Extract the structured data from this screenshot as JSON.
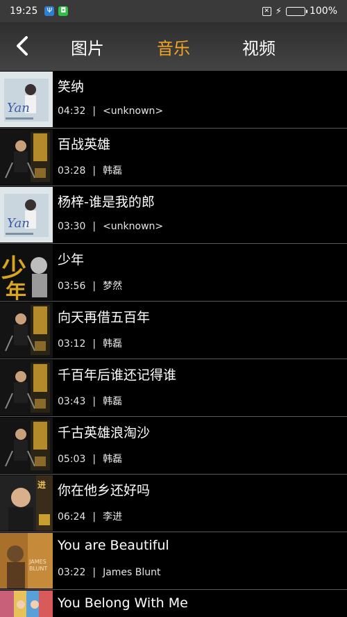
{
  "status": {
    "time": "19:25",
    "battery_percent": "100%",
    "battery_level": 1.0
  },
  "header": {
    "tabs": [
      {
        "label": "图片",
        "active": false
      },
      {
        "label": "音乐",
        "active": true
      },
      {
        "label": "视频",
        "active": false
      }
    ],
    "active_color": "#f5a623"
  },
  "songs": [
    {
      "title": "笑纳",
      "duration": "04:32",
      "sep": "|",
      "artist": "<unknown>",
      "art": "light"
    },
    {
      "title": "百战英雄",
      "duration": "03:28",
      "sep": "|",
      "artist": "韩磊",
      "art": "dark-gold"
    },
    {
      "title": "杨梓-谁是我的郎",
      "duration": "03:30",
      "sep": "|",
      "artist": "<unknown>",
      "art": "light"
    },
    {
      "title": "少年",
      "duration": "03:56",
      "sep": "|",
      "artist": "梦然",
      "art": "gold-text"
    },
    {
      "title": "向天再借五百年",
      "duration": "03:12",
      "sep": "|",
      "artist": "韩磊",
      "art": "dark-gold"
    },
    {
      "title": "千百年后谁还记得谁",
      "duration": "03:43",
      "sep": "|",
      "artist": "韩磊",
      "art": "dark-gold"
    },
    {
      "title": "千古英雄浪淘沙",
      "duration": "05:03",
      "sep": "|",
      "artist": "韩磊",
      "art": "dark-gold"
    },
    {
      "title": "你在他乡还好吗",
      "duration": "06:24",
      "sep": "|",
      "artist": "李进",
      "art": "portrait"
    },
    {
      "title": "You are Beautiful",
      "duration": "03:22",
      "sep": "|",
      "artist": "James Blunt",
      "art": "warm"
    },
    {
      "title": "You Belong With Me",
      "duration": "",
      "sep": "",
      "artist": "",
      "art": "colorful"
    }
  ]
}
